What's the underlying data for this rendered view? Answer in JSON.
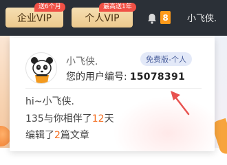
{
  "header": {
    "enterprise_vip": {
      "label": "企业VIP",
      "promo": "送6个月"
    },
    "personal_vip": {
      "label": "个人VIP",
      "promo": "最高送1年"
    },
    "notifications": {
      "count": "8"
    },
    "username": "小飞侠."
  },
  "profile_card": {
    "name": "小飞侠.",
    "plan": "免费版-个人",
    "uid_label": "您的用户编号:",
    "uid_value": "15078391",
    "greeting": "hi~小飞侠.",
    "days_prefix": "135与你相伴了",
    "days_value": "12",
    "days_suffix": "天",
    "articles_prefix": "编辑了",
    "articles_value": "2",
    "articles_suffix": "篇文章"
  },
  "colors": {
    "topbar": "#2b3037",
    "vip_gold": "#ecc98d",
    "promo_red": "#f05045",
    "badge_orange": "#ff9a1a",
    "highlight": "#f36b1c",
    "arrow": "#e8524f"
  },
  "icons": {
    "bell": "bell-icon",
    "avatar": "panda-avatar-icon",
    "arrow": "pointer-arrow-icon"
  }
}
